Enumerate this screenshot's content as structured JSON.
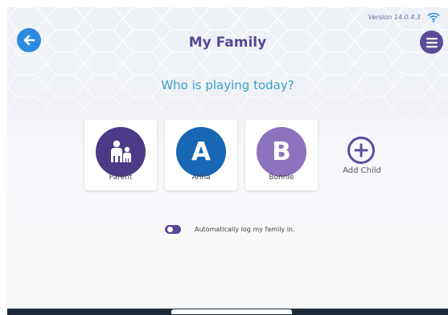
{
  "status_bar": {
    "version": "Version 14.0.4.3",
    "wifi_icon": "wifi-icon"
  },
  "header": {
    "title": "My Family",
    "back_icon": "arrow-left-icon",
    "menu_icon": "hamburger-menu-icon"
  },
  "prompt": "Who is playing today?",
  "profiles": [
    {
      "label": "Parent",
      "avatar_icon": "parent-child-icon",
      "color": "#4b3a86"
    },
    {
      "label": "Anna",
      "avatar_letter": "A",
      "color": "#1767b4"
    },
    {
      "label": "Bonnie",
      "avatar_letter": "B",
      "color": "#8c73bd"
    }
  ],
  "add_child": {
    "label": "Add Child",
    "icon": "plus-circle-icon",
    "color": "#5f4c9e"
  },
  "auto_login": {
    "label": "Automatically log my family in.",
    "enabled": true
  },
  "colors": {
    "primary": "#5a4796",
    "accent_blue": "#2b8be0",
    "subtitle": "#3ba0c2",
    "bottom_bar": "#1d2a3b"
  }
}
